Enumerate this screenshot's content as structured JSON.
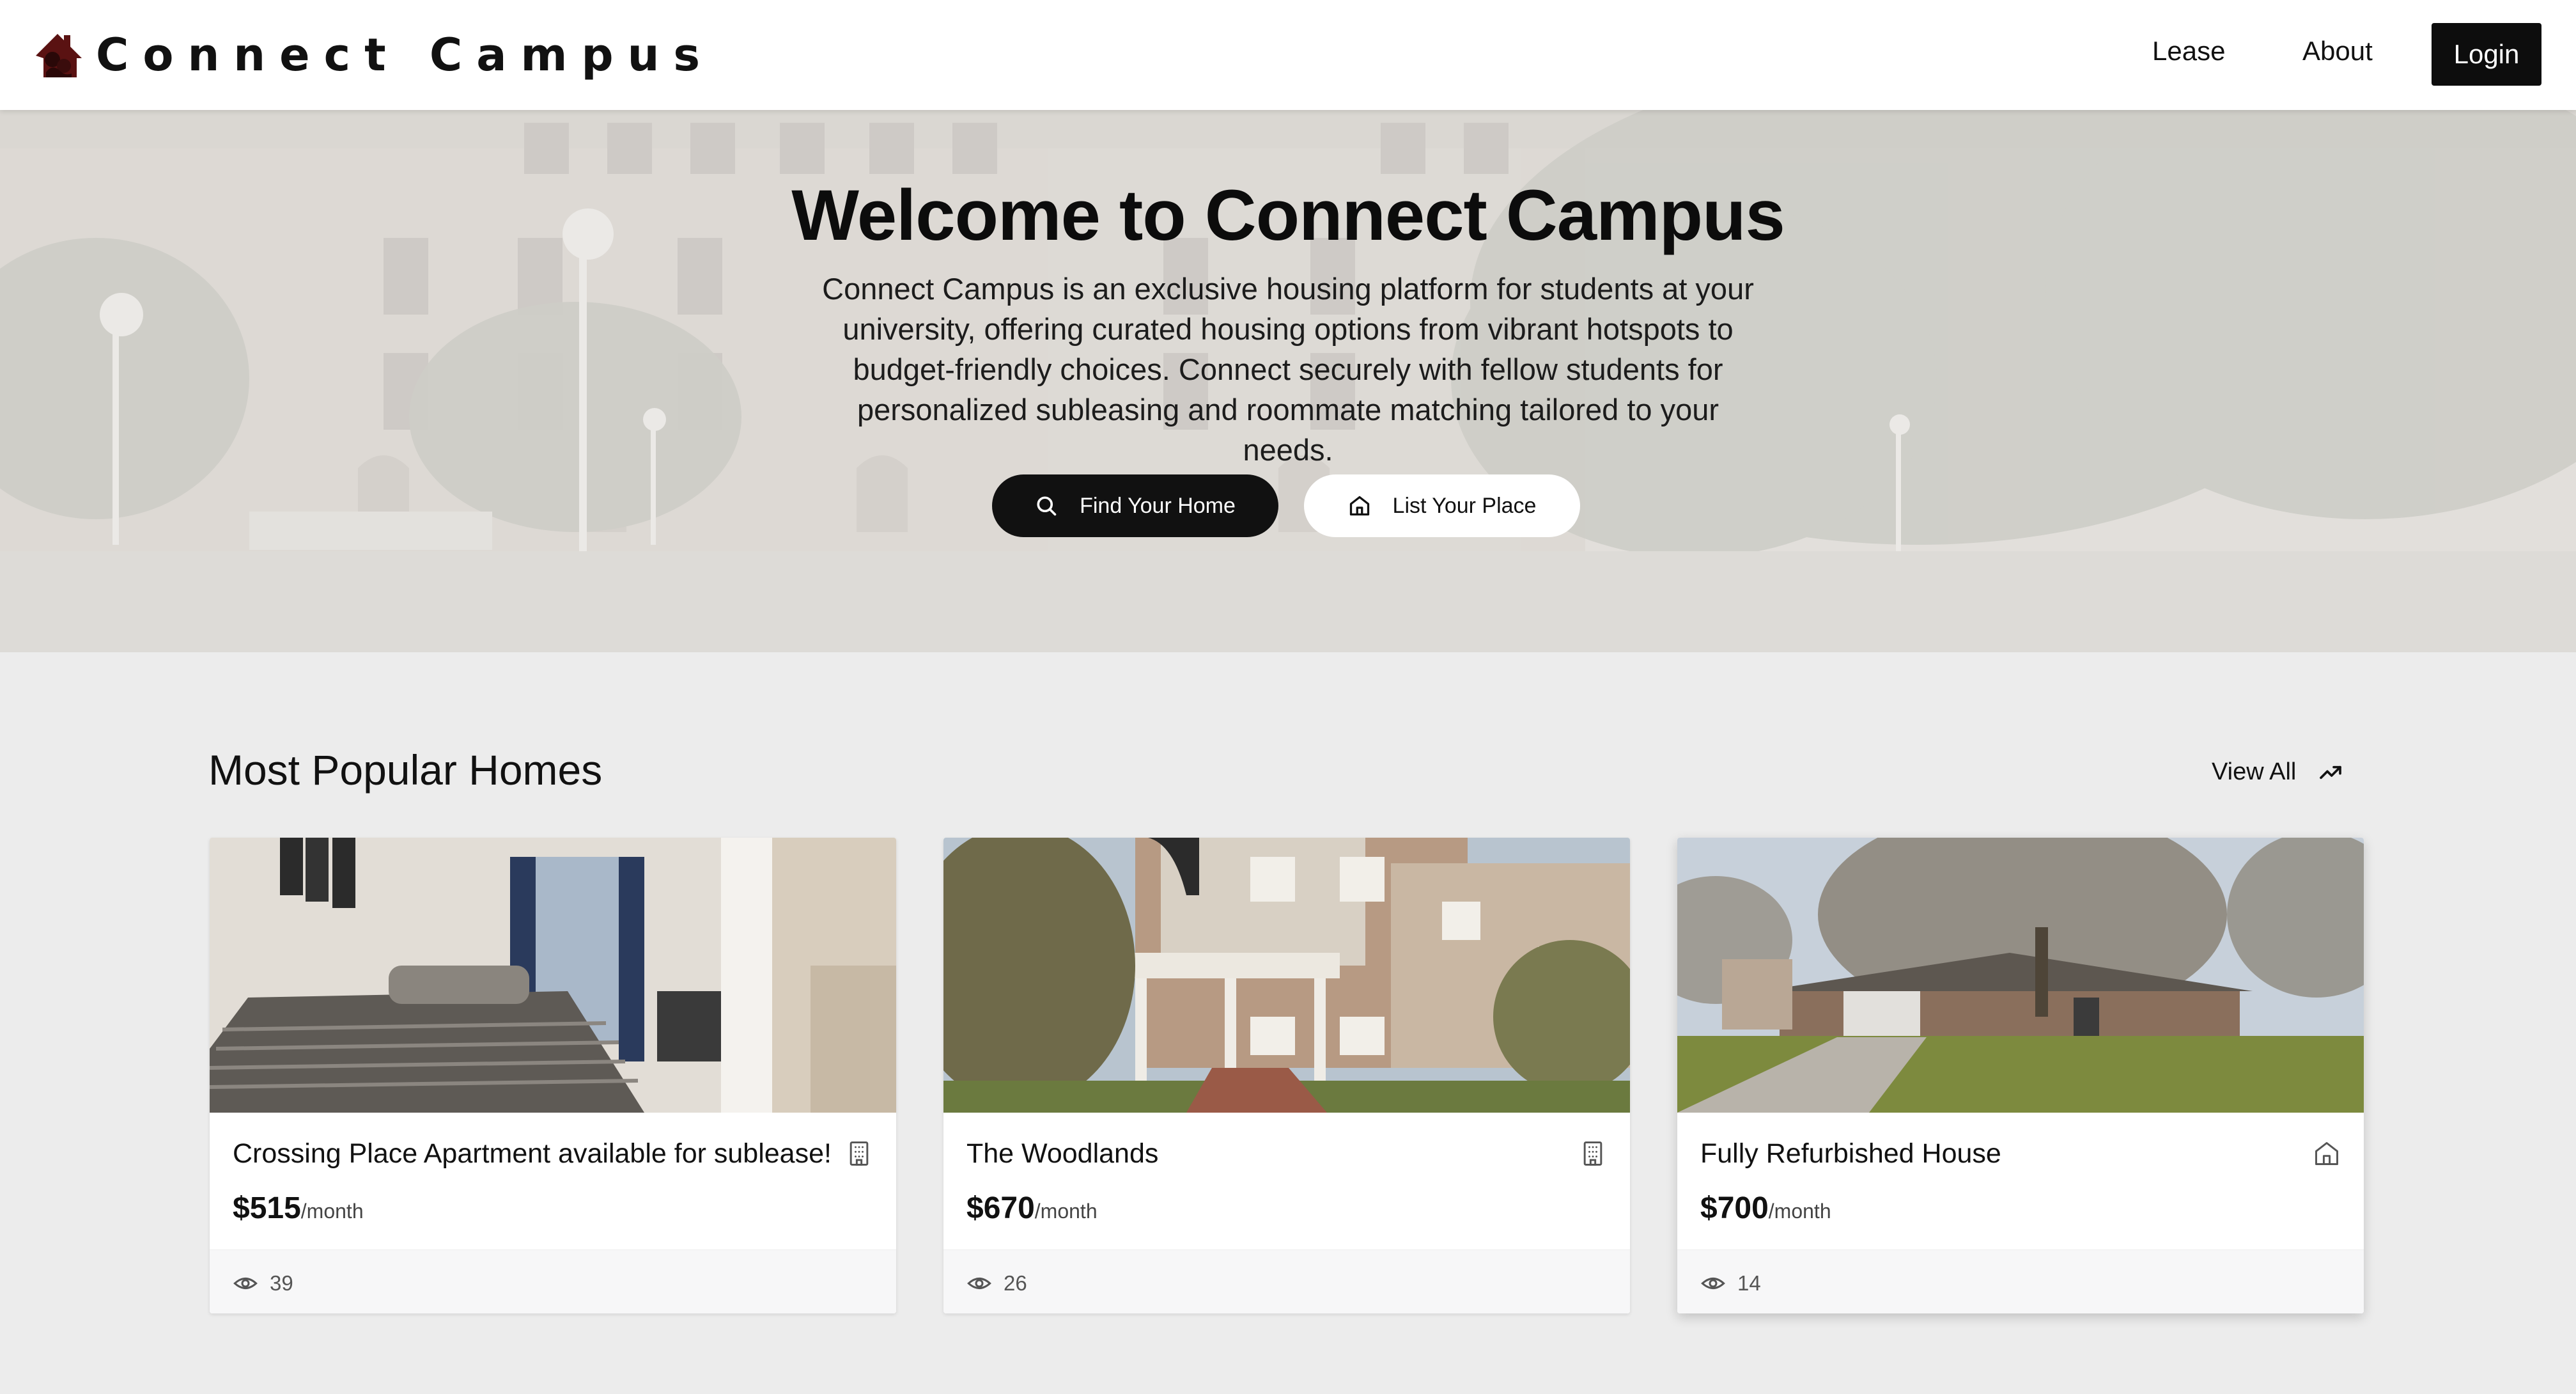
{
  "navbar": {
    "brand": "Connect Campus",
    "links": [
      {
        "label": "Lease"
      },
      {
        "label": "About"
      }
    ],
    "login_label": "Login",
    "logo_icon": "house-logo-icon",
    "logo_color": "#5a1212"
  },
  "hero": {
    "title": "Welcome to Connect Campus",
    "description": "Connect Campus is an exclusive housing platform for students at your university, offering curated housing options from vibrant hotspots to budget-friendly choices. Connect securely with fellow students for personalized subleasing and roommate matching tailored to your needs.",
    "primary_button": {
      "label": "Find Your Home",
      "icon": "search-icon"
    },
    "secondary_button": {
      "label": "List Your Place",
      "icon": "home-icon"
    }
  },
  "popular": {
    "title": "Most Popular Homes",
    "view_all_label": "View All",
    "view_all_icon": "trending-up-icon",
    "listings": [
      {
        "title": "Crossing Place Apartment available for sublease!",
        "price": "$515",
        "unit": "/month",
        "views": "39",
        "type_icon": "building-icon"
      },
      {
        "title": "The Woodlands",
        "price": "$670",
        "unit": "/month",
        "views": "26",
        "type_icon": "building-icon"
      },
      {
        "title": "Fully Refurbished House",
        "price": "$700",
        "unit": "/month",
        "views": "14",
        "type_icon": "home-icon"
      }
    ]
  }
}
